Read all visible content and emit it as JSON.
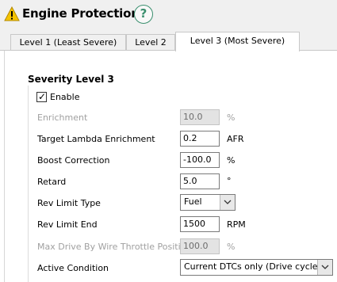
{
  "header": {
    "title": "Engine Protection",
    "help_icon": "?",
    "warning_icon": "warning-triangle-icon",
    "help_color": "#3a8f6e"
  },
  "tabs": [
    {
      "label": "Level 1 (Least Severe)",
      "selected": false
    },
    {
      "label": "Level 2",
      "selected": false
    },
    {
      "label": "Level 3 (Most Severe)",
      "selected": true
    }
  ],
  "group": {
    "title": "Severity Level 3",
    "enable_label": "Enable",
    "enable_checked": true,
    "check_mark": "✓"
  },
  "fields": {
    "enrichment": {
      "label": "Enrichment",
      "value": "10.0",
      "unit": "%",
      "enabled": false
    },
    "target_lambda": {
      "label": "Target Lambda Enrichment",
      "value": "0.2",
      "unit": "AFR",
      "enabled": true
    },
    "boost_correction": {
      "label": "Boost Correction",
      "value": "-100.0",
      "unit": "%",
      "enabled": true
    },
    "retard": {
      "label": "Retard",
      "value": "5.0",
      "unit": "°",
      "enabled": true
    },
    "rev_limit_type": {
      "label": "Rev Limit Type",
      "value": "Fuel",
      "enabled": true
    },
    "rev_limit_end": {
      "label": "Rev Limit End",
      "value": "1500",
      "unit": "RPM",
      "enabled": true
    },
    "max_dbw": {
      "label": "Max Drive By Wire Throttle Position",
      "value": "100.0",
      "unit": "%",
      "enabled": false
    },
    "active_condition": {
      "label": "Active Condition",
      "value": "Current DTCs only (Drive cycle)",
      "enabled": true
    }
  }
}
